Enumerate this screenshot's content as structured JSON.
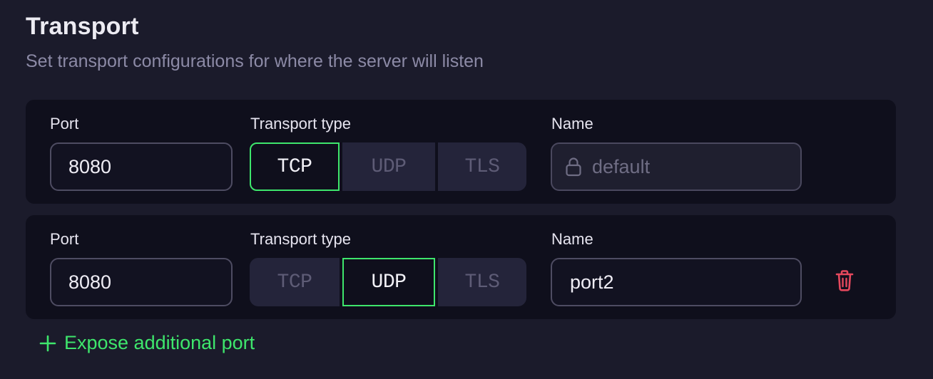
{
  "section": {
    "title": "Transport",
    "subtitle": "Set transport configurations for where the server will listen"
  },
  "transports": [
    {
      "port_label": "Port",
      "port_value": "8080",
      "type_label": "Transport type",
      "type_options": [
        "TCP",
        "UDP",
        "TLS"
      ],
      "selected_type": "TCP",
      "name_label": "Name",
      "name_value": "default",
      "name_locked": true
    },
    {
      "port_label": "Port",
      "port_value": "8080",
      "type_label": "Transport type",
      "type_options": [
        "TCP",
        "UDP",
        "TLS"
      ],
      "selected_type": "UDP",
      "name_label": "Name",
      "name_value": "port2",
      "name_locked": false,
      "delete_icon": "trash-icon"
    }
  ],
  "add_port": {
    "icon": "plus-icon",
    "label": "Expose additional port"
  },
  "colors": {
    "background": "#1b1b2b",
    "card": "#0f0f1c",
    "accent_green": "#3ee66c",
    "delete_red": "#e5485d",
    "muted_text": "#8c8aa6"
  }
}
